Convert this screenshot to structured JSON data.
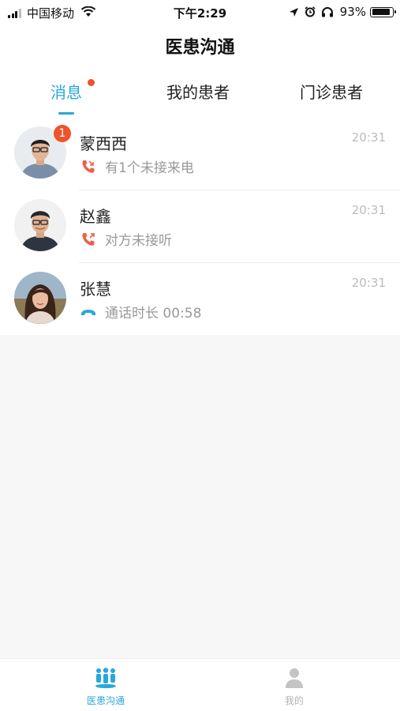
{
  "status_bar": {
    "carrier": "中国移动",
    "time": "下午2:29",
    "battery": "93%"
  },
  "nav": {
    "title": "医患沟通"
  },
  "tabs": [
    {
      "label": "消息",
      "active": true,
      "has_dot": true
    },
    {
      "label": "我的患者",
      "active": false
    },
    {
      "label": "门诊患者",
      "active": false
    }
  ],
  "conversations": [
    {
      "name": "蒙西西",
      "time": "20:31",
      "badge": "1",
      "status": "有1个未接来电",
      "status_icon": "missed-call-icon"
    },
    {
      "name": "赵鑫",
      "time": "20:31",
      "status": "对方未接听",
      "status_icon": "unanswered-call-icon"
    },
    {
      "name": "张慧",
      "time": "20:31",
      "status": "通话时长 00:58",
      "status_icon": "call-ended-icon"
    }
  ],
  "tab_bar": [
    {
      "label": "医患沟通",
      "icon": "people-icon",
      "active": true
    },
    {
      "label": "我的",
      "icon": "person-icon",
      "active": false
    }
  ],
  "colors": {
    "accent": "#2aa7d8",
    "badge": "#f0522b",
    "missed": "#e8624a"
  }
}
